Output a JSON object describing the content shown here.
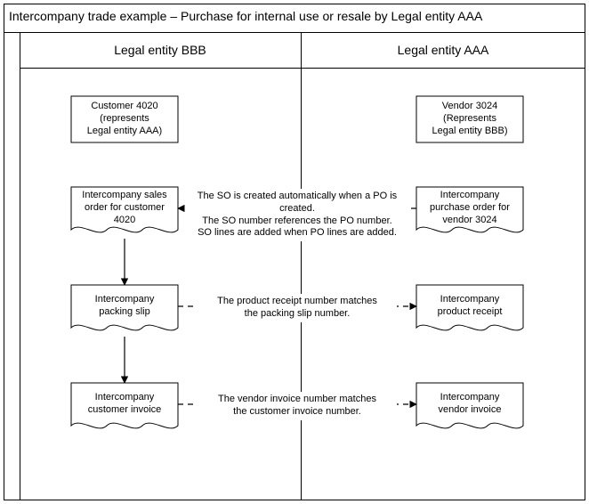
{
  "title": "Intercompany trade example –  Purchase for internal use or resale by Legal entity AAA",
  "columns": {
    "left": "Legal entity BBB",
    "right": "Legal entity AAA"
  },
  "boxes": {
    "customer4020": "Customer 4020\n(represents\nLegal entity AAA)",
    "vendor3024": "Vendor 3024\n(Represents\nLegal entity BBB)",
    "icSalesOrder": "Intercompany sales\norder for customer\n4020",
    "icPurchaseOrder": "Intercompany\npurchase order for\nvendor 3024",
    "icPackingSlip": "Intercompany\npacking slip",
    "icProductReceipt": "Intercompany\nproduct receipt",
    "icCustomerInvoice": "Intercompany\ncustomer invoice",
    "icVendorInvoice": "Intercompany\nvendor invoice"
  },
  "flows": {
    "so_created": "The SO is created automatically when a PO is created.\nThe SO number references the PO number.\nSO lines are added when PO  lines are added.",
    "product_receipt_match": "The product receipt number matches\nthe packing slip number.",
    "vendor_invoice_match": "The vendor invoice number matches\nthe customer invoice number."
  }
}
